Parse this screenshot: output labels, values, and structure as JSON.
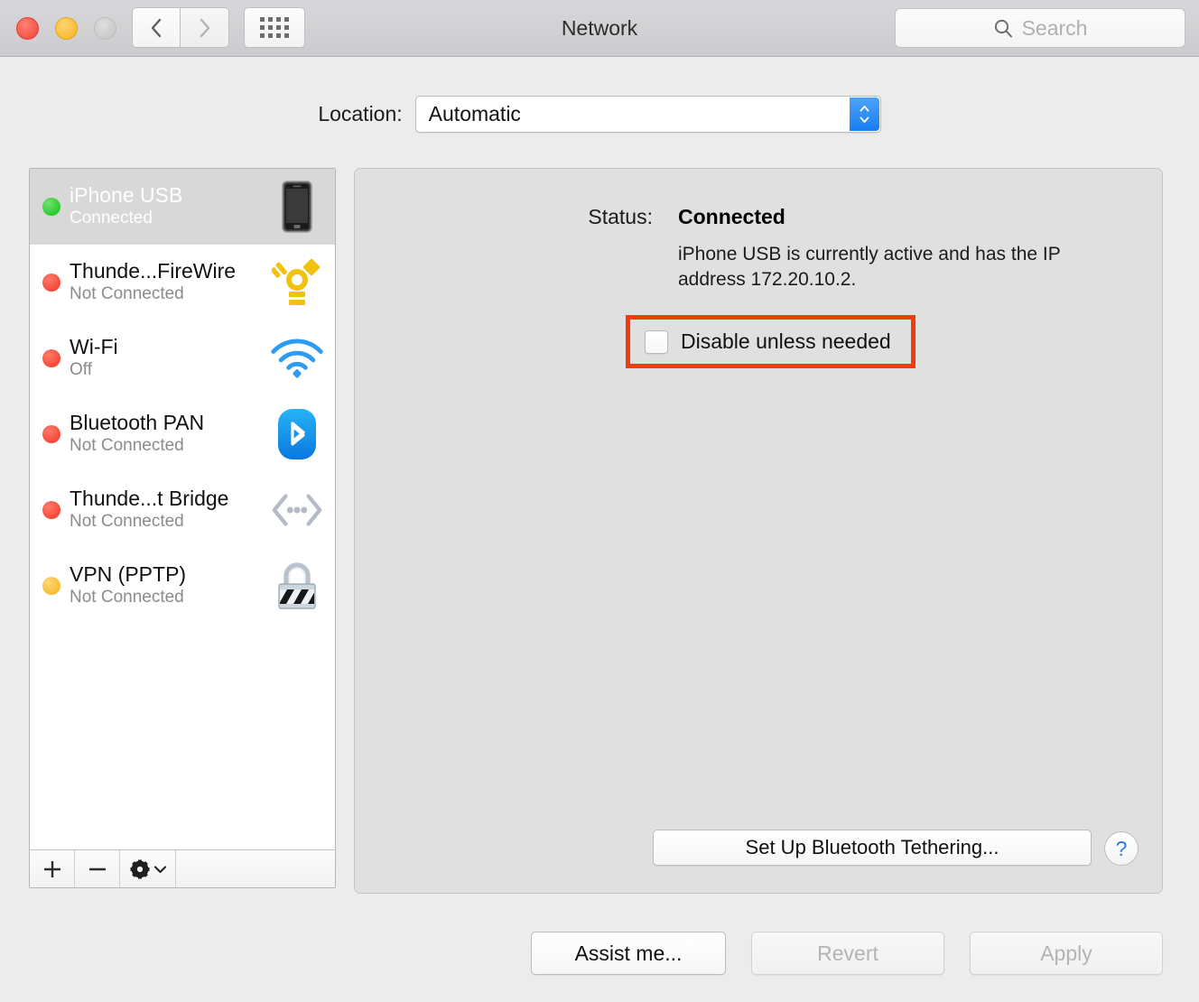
{
  "window": {
    "title": "Network",
    "traffic_lights": [
      "close",
      "minimize",
      "zoom-disabled"
    ],
    "nav": {
      "back": "back-icon",
      "forward": "forward-icon",
      "grid": "show-all-icon"
    },
    "search": {
      "placeholder": "Search",
      "icon": "search-icon",
      "value": ""
    }
  },
  "location": {
    "label": "Location:",
    "selected": "Automatic",
    "options": [
      "Automatic"
    ]
  },
  "services": [
    {
      "name": "iPhone USB",
      "status": "Connected",
      "dot": "green",
      "icon": "iphone-icon",
      "selected": true
    },
    {
      "name": "Thunde...FireWire",
      "status": "Not Connected",
      "dot": "red",
      "icon": "firewire-icon",
      "selected": false
    },
    {
      "name": "Wi-Fi",
      "status": "Off",
      "dot": "red",
      "icon": "wifi-icon",
      "selected": false
    },
    {
      "name": "Bluetooth PAN",
      "status": "Not Connected",
      "dot": "red",
      "icon": "bluetooth-icon",
      "selected": false
    },
    {
      "name": "Thunde...t Bridge",
      "status": "Not Connected",
      "dot": "red",
      "icon": "thunderbolt-bridge-icon",
      "selected": false
    },
    {
      "name": "VPN (PPTP)",
      "status": "Not Connected",
      "dot": "yellow",
      "icon": "vpn-lock-icon",
      "selected": false
    }
  ],
  "service_toolbar": {
    "add": "+",
    "remove": "−",
    "actions_icon": "gear-icon"
  },
  "detail": {
    "status_label": "Status:",
    "status_value": "Connected",
    "status_description": "iPhone USB is currently active and has the IP address 172.20.10.2.",
    "checkbox": {
      "label": "Disable unless needed",
      "checked": false,
      "highlighted": true
    },
    "tethering_button": "Set Up Bluetooth Tethering...",
    "help_button": "?"
  },
  "footer": {
    "assist": "Assist me...",
    "revert": "Revert",
    "apply": "Apply",
    "revert_enabled": false,
    "apply_enabled": false
  },
  "colors": {
    "annotation": "#f23a0c",
    "accent_blue": "#1a7df2",
    "status_green": "#2ecb2e",
    "status_red": "#f74a3b",
    "status_yellow": "#f8bd33"
  }
}
